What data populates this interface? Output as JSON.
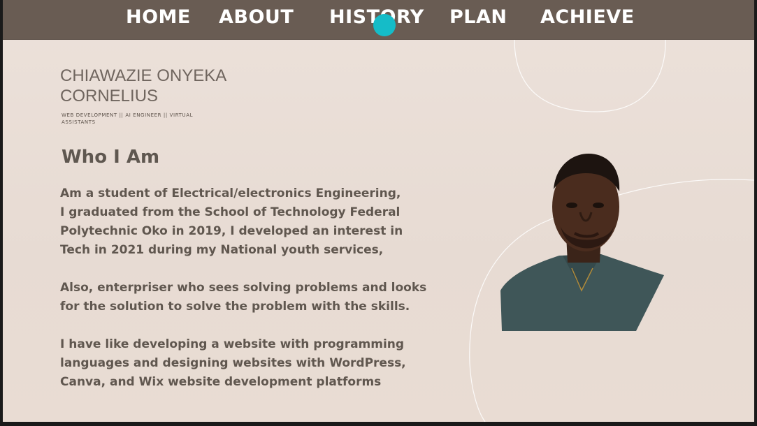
{
  "nav": {
    "items": [
      {
        "label": "HOME"
      },
      {
        "label": "ABOUT"
      },
      {
        "label": "HISTORY"
      },
      {
        "label": "PLAN"
      },
      {
        "label": "ACHIEVE"
      }
    ]
  },
  "profile": {
    "name_line1": "CHIAWAZIE ONYEKA",
    "name_line2": "CORNELIUS",
    "tagline": "WEB DEVELOPMENT || AI ENGINEER || VIRTUAL ASSISTANTS",
    "photo_icon": "profile-photo"
  },
  "about": {
    "heading": "Who I Am",
    "paragraph1": "Am a student of Electrical/electronics Engineering,\nI graduated from the School of Technology Federal\nPolytechnic Oko in 2019, I developed an interest in\nTech in 2021 during my National youth services,",
    "paragraph2": "Also, enterpriser who sees solving problems and looks\nfor the solution to solve the problem with the skills.",
    "paragraph3": "I have like developing a website with programming\nlanguages and designing websites with WordPress,\nCanva, and Wix website development platforms"
  },
  "colors": {
    "nav_bg": "#695c53",
    "page_bg": "#ece1da",
    "text": "#60574f",
    "cursor": "#15bcc8"
  }
}
